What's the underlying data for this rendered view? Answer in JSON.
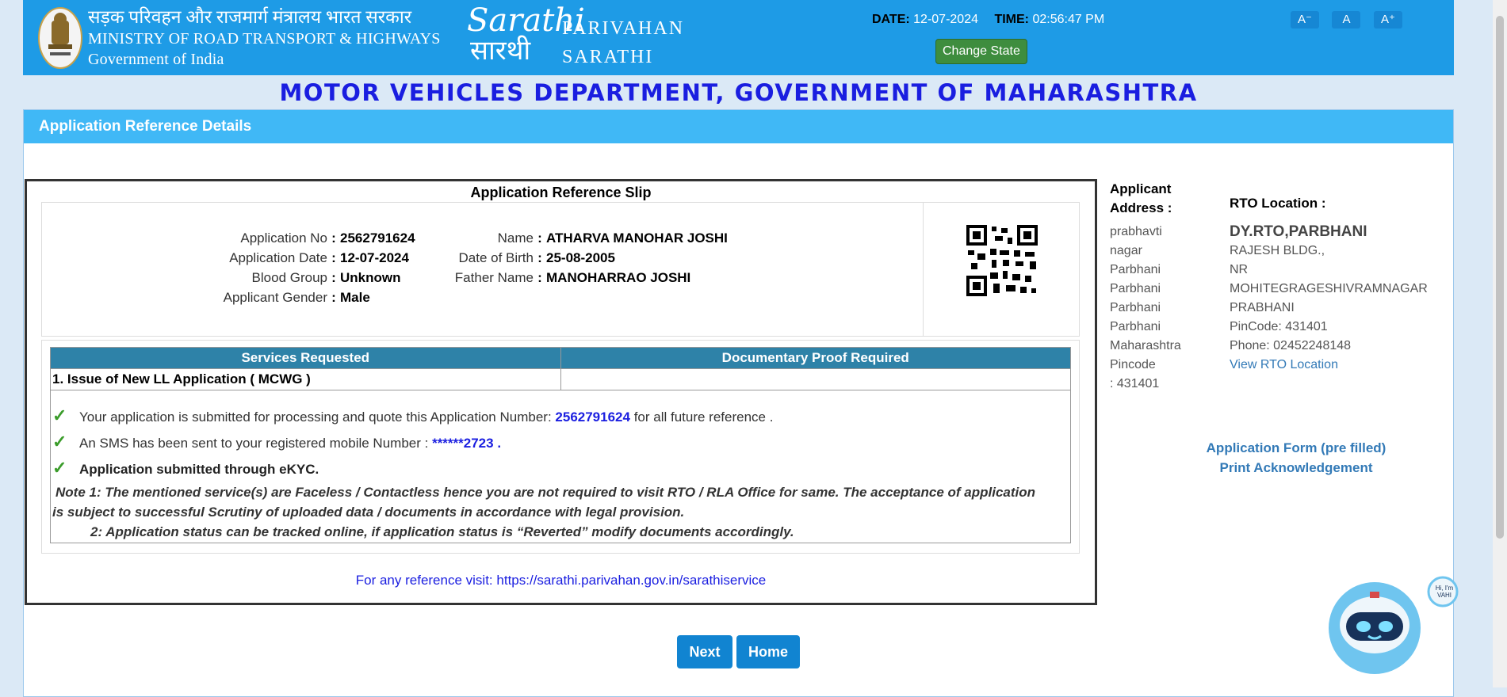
{
  "header": {
    "ministry_hindi": "सड़क परिवहन और राजमार्ग मंत्रालय भारत सरकार",
    "ministry_english": "MINISTRY OF ROAD TRANSPORT & HIGHWAYS",
    "gov": "Government of India",
    "logo_script_1": "Sarathi",
    "logo_script_2": "सारथी",
    "logo_word_1": "PARIVAHAN",
    "logo_word_2": "SARATHI",
    "date_label": "DATE:",
    "date_value": "12-07-2024",
    "time_label": "TIME:",
    "time_value": "02:56:47 PM",
    "change_state": "Change State",
    "font_small": "A⁻",
    "font_normal": "A",
    "font_large": "A⁺"
  },
  "dept_title": "MOTOR VEHICLES DEPARTMENT, GOVERNMENT OF MAHARASHTRA",
  "panel_title": "Application Reference Details",
  "slip": {
    "title": "Application Reference Slip",
    "app_no_label": "Application No",
    "app_no": "2562791624",
    "app_date_label": "Application Date",
    "app_date": "12-07-2024",
    "blood_label": "Blood Group",
    "blood": "Unknown",
    "gender_label": "Applicant Gender",
    "gender": "Male",
    "name_label": "Name",
    "name": "ATHARVA MANOHAR JOSHI",
    "dob_label": "Date of Birth",
    "dob": "25-08-2005",
    "father_label": "Father Name",
    "father": "MANOHARRAO JOSHI",
    "colon": ":"
  },
  "services": {
    "col1": "Services Requested",
    "col2": "Documentary Proof Required",
    "row1": "1. Issue of New LL Application ( MCWG )",
    "row1_proof": ""
  },
  "messages": {
    "m1_pre": "Your application is submitted for processing and quote this Application Number:",
    "m1_num": "2562791624",
    "m1_post": "for all future reference .",
    "m2_pre": "An SMS has been sent to your registered mobile Number :",
    "m2_num": "******2723 .",
    "m3": "Application submitted through eKYC.",
    "note1": "Note 1:  The mentioned service(s) are Faceless / Contactless hence you are not required to visit RTO / RLA Office for same. The acceptance of application",
    "note1b": "is subject to successful Scrutiny of uploaded data / documents in accordance with legal provision.",
    "note2": "2:  Application status can be tracked online, if application status is “Reverted” modify documents accordingly."
  },
  "reference": {
    "pre": "For any reference visit:",
    "url": "https://sarathi.parivahan.gov.in/sarathiservice"
  },
  "address": {
    "heading_1": "Applicant",
    "heading_2": "Address :",
    "lines": [
      "prabhavti",
      "nagar",
      "Parbhani",
      "Parbhani",
      "Parbhani",
      "Parbhani",
      "Maharashtra",
      "Pincode",
      ": 431401"
    ]
  },
  "rto": {
    "heading": "RTO Location :",
    "name": "DY.RTO,PARBHANI",
    "lines": [
      "RAJESH BLDG.,",
      "NR",
      "MOHITEGRAGESHIVRAMNAGAR",
      "PRABHANI",
      "PinCode:  431401",
      "Phone:  02452248148"
    ],
    "view_link": "View RTO Location"
  },
  "links": {
    "form": "Application Form (pre filled)",
    "print": "Print Acknowledgement"
  },
  "buttons": {
    "next": "Next",
    "home": "Home"
  },
  "chatbot": {
    "bubble": "Hi, I'm VAHI"
  }
}
